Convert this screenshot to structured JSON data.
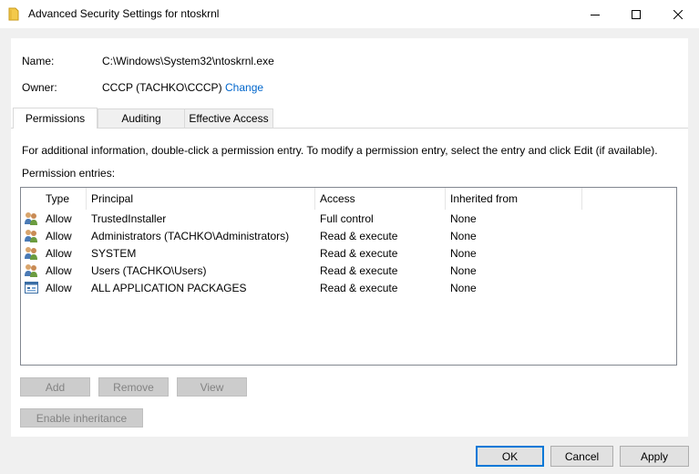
{
  "window": {
    "title": "Advanced Security Settings for ntoskrnl"
  },
  "file": {
    "name_label": "Name:",
    "name_value": "C:\\Windows\\System32\\ntoskrnl.exe",
    "owner_label": "Owner:",
    "owner_value": "CCCP (TACHKO\\CCCP)",
    "change_label": "Change"
  },
  "tabs": [
    {
      "label": "Permissions",
      "active": true
    },
    {
      "label": "Auditing",
      "active": false
    },
    {
      "label": "Effective Access",
      "active": false
    }
  ],
  "info_text": "For additional information, double-click a permission entry. To modify a permission entry, select the entry and click Edit (if available).",
  "entries_label": "Permission entries:",
  "columns": {
    "type": "Type",
    "principal": "Principal",
    "access": "Access",
    "inherited": "Inherited from"
  },
  "entries": [
    {
      "icon": "users-group-icon",
      "type": "Allow",
      "principal": "TrustedInstaller",
      "access": "Full control",
      "inherited": "None"
    },
    {
      "icon": "users-group-icon",
      "type": "Allow",
      "principal": "Administrators (TACHKO\\Administrators)",
      "access": "Read & execute",
      "inherited": "None"
    },
    {
      "icon": "users-group-icon",
      "type": "Allow",
      "principal": "SYSTEM",
      "access": "Read & execute",
      "inherited": "None"
    },
    {
      "icon": "users-group-icon",
      "type": "Allow",
      "principal": "Users (TACHKO\\Users)",
      "access": "Read & execute",
      "inherited": "None"
    },
    {
      "icon": "app-package-icon",
      "type": "Allow",
      "principal": "ALL APPLICATION PACKAGES",
      "access": "Read & execute",
      "inherited": "None"
    }
  ],
  "buttons": {
    "add": "Add",
    "remove": "Remove",
    "view": "View",
    "enable_inheritance": "Enable inheritance",
    "ok": "OK",
    "cancel": "Cancel",
    "apply": "Apply"
  },
  "colors": {
    "link": "#0066cc",
    "accent": "#0078d7",
    "disabled_text": "#838383"
  }
}
